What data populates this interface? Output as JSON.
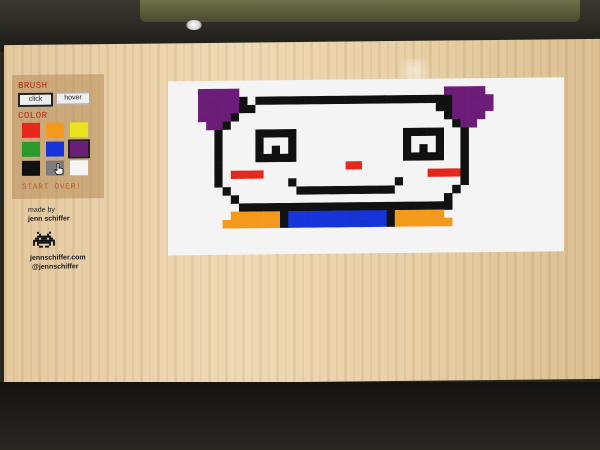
{
  "sidebar": {
    "brush_title": "BRUSH",
    "brush_modes": [
      {
        "label": "click",
        "active": true
      },
      {
        "label": "hover",
        "active": false
      }
    ],
    "color_title": "COLOR",
    "colors": [
      "#e8271c",
      "#f39a1c",
      "#e9e21f",
      "#2a9a2e",
      "#1634d9",
      "#6b1d78",
      "#111111",
      "#7d7d7d",
      "#f4f4f4"
    ],
    "selected_color_index": 5,
    "start_over_label": "START OVER!",
    "made_by_label": "made by",
    "author_name": "jenn schiffer",
    "website": "jennschiffer.com",
    "handle": "@jennschiffer"
  },
  "canvas": {
    "palette": {
      "P": "#6b1d78",
      "K": "#111111",
      "R": "#e8271c",
      "O": "#f39a1c",
      "B": "#1634d9",
      "W": "#f4f4f4"
    },
    "background": "#f4f4f4",
    "cell_rows": [
      "PPPPP.........................PPPPP.............",
      "PPPPPK.KKKKKKKKKKKKKKKKKKKKKKKKPPPPP.............",
      "PPPPPKKWWWWWWWWWWWWWWWWWWWWWWKKPPPPP.............",
      "PPPPKWWWWWWWWWWWWWWWWWWWWWWWWWKPPPP..............",
      ".PPKWWWWWWWWWWWWWWWWWWWWWWWWWWWKPP...............",
      "..KWWWWKKKKKWWWWWWWWWWWWWKKKKKWWK................",
      "..KWWWWKWWWKWWWWWWWWWWWWWKWWWKWWK................",
      "..KWWWWKWKWKWWWWWWWWWWWWWKWKWKWWK................",
      "..KWWWWKKKKKWWWWWWWWWWWWWKKKKKWWK................",
      "..KWWWWWWWWWWWWWWWRRWWWWWWWWWWWWK................",
      "..KWRRRRWWWWWWWWWWWWWWWWWWWWRRRRK................",
      "..KWWWWWWWWKWWWWWWWWWWWWKWWWWWWWK................",
      "...KWWWWWWWWKKKKKKKKKKKKWWWWWWWK.................",
      "....KWWWWWWWWWWWWWWWWWWWWWWWWWK..................",
      ".....KKKKKKKKKKKKKKKKKKKKKKKKKK..................",
      "....OOOOOOKBBBBBBBBBBBBKOOOOOO...................",
      "...OOOOOOOKBBBBBBBBBBBBKOOOOOOO.................."
    ]
  }
}
